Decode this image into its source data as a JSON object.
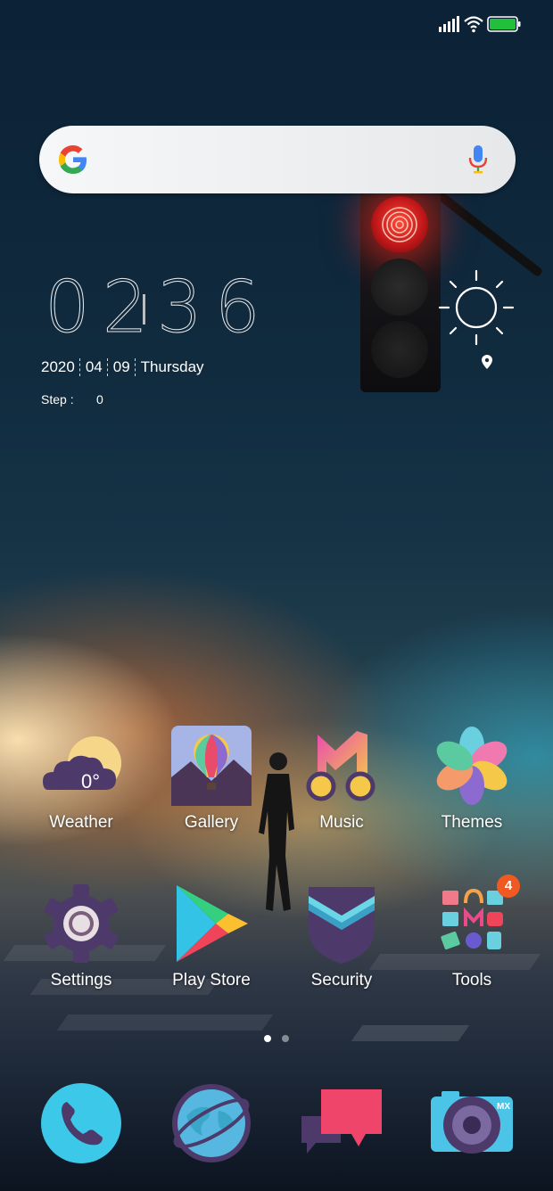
{
  "status_bar": {
    "signal_icon": "cellular-signal-icon",
    "wifi_icon": "wifi-icon",
    "battery_icon": "battery-full-icon",
    "battery_color": "#22c03a"
  },
  "search": {
    "logo_icon": "google-g-icon",
    "mic_icon": "microphone-icon"
  },
  "clock": {
    "hours": "02",
    "minutes": "36",
    "year": "2020",
    "month": "04",
    "day": "09",
    "weekday": "Thursday",
    "step_label": "Step :",
    "step_value": "0"
  },
  "weather_widget": {
    "condition_icon": "sun-icon",
    "location_icon": "location-pin-icon"
  },
  "apps": {
    "weather": {
      "label": "Weather",
      "temp": "0°"
    },
    "gallery": {
      "label": "Gallery"
    },
    "music": {
      "label": "Music"
    },
    "themes": {
      "label": "Themes"
    },
    "settings": {
      "label": "Settings"
    },
    "playstore": {
      "label": "Play Store"
    },
    "security": {
      "label": "Security"
    },
    "tools": {
      "label": "Tools",
      "badge": "4"
    }
  },
  "page_indicator": {
    "pages": 2,
    "current": 1
  },
  "dock": [
    "phone-icon",
    "browser-icon",
    "messages-icon",
    "camera-icon"
  ]
}
